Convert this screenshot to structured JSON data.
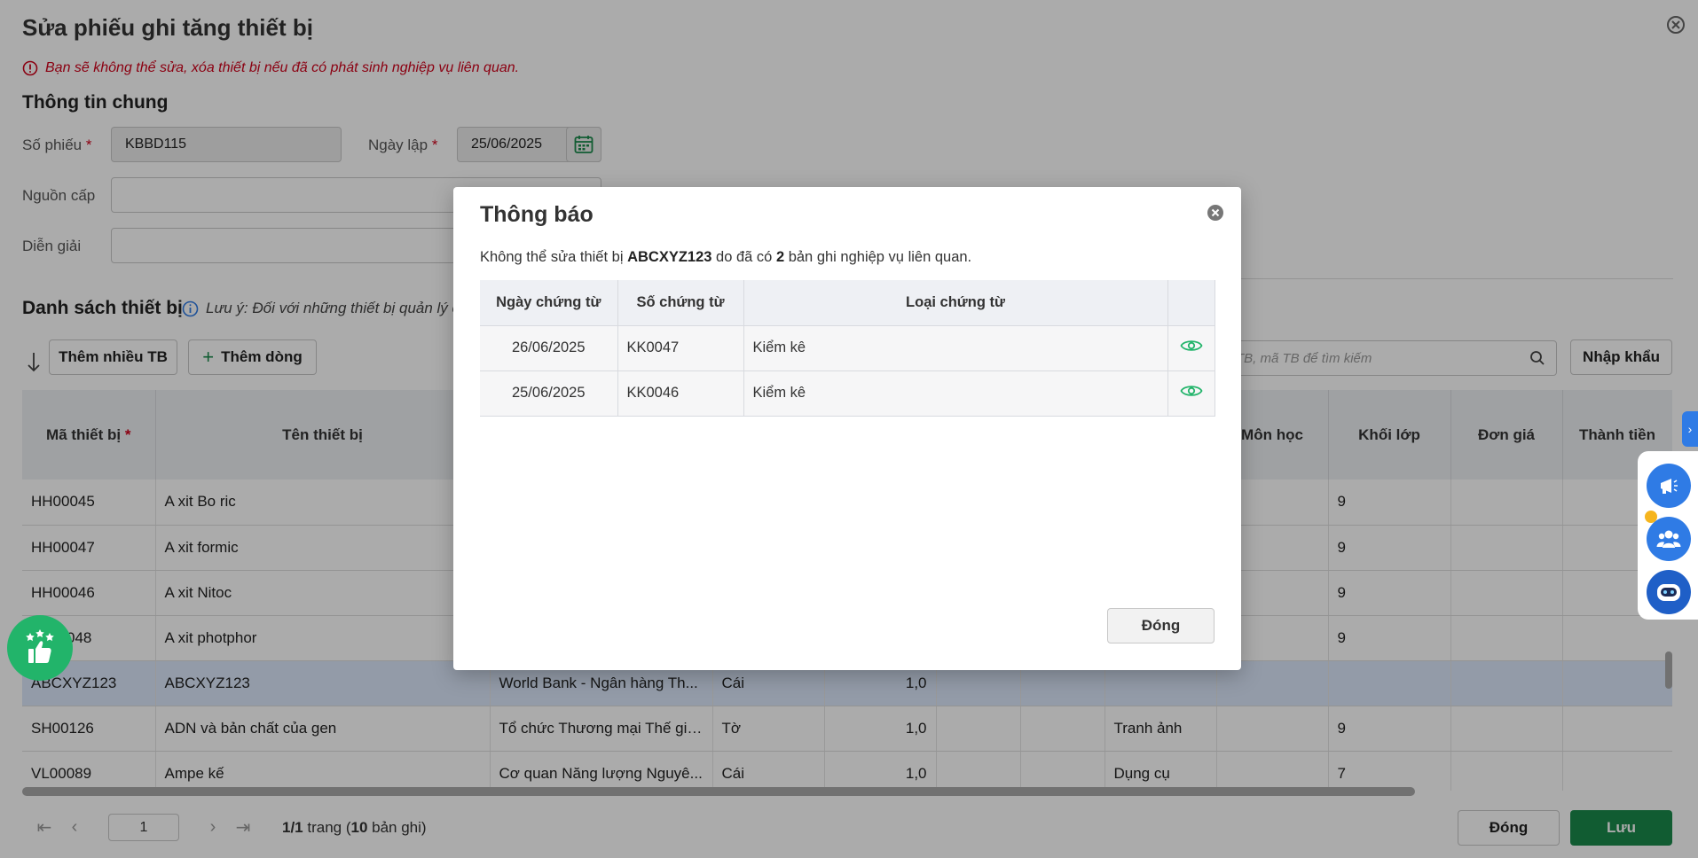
{
  "page": {
    "title": "Sửa phiếu ghi tăng thiết bị",
    "warning": "Bạn sẽ không thể sửa, xóa thiết bị nếu đã có phát sinh nghiệp vụ liên quan.",
    "general_section": "Thông tin chung",
    "form": {
      "so_phieu_label": "Số phiếu",
      "so_phieu_value": "KBBD115",
      "ngay_lap_label": "Ngày lập",
      "ngay_lap_value": "25/06/2025",
      "nguon_cap_label": "Nguồn cấp",
      "dien_giai_label": "Diễn giải",
      "required_mark": "*"
    },
    "list_title": "Danh sách thiết bị",
    "list_note": "Lưu ý: Đối với những thiết bị quản lý c",
    "toolbar": {
      "add_many": "Thêm nhiều TB",
      "add_row": "Thêm dòng",
      "search_placeholder": "TB, mã TB để tìm kiếm",
      "import": "Nhập khẩu"
    },
    "columns": [
      "Mã thiết bị",
      "Tên thiết bị",
      "",
      "",
      "",
      "",
      "",
      "",
      "Môn học",
      "Khối lớp",
      "Đơn giá",
      "Thành tiền"
    ],
    "rows": [
      {
        "ma": "HH00045",
        "ten": "A xit Bo ric",
        "nguon": "",
        "dvt": "",
        "sl": "",
        "mon": "",
        "khoi": "9"
      },
      {
        "ma": "HH00047",
        "ten": "A xit formic",
        "nguon": "",
        "dvt": "",
        "sl": "",
        "mon": "",
        "khoi": "9"
      },
      {
        "ma": "HH00046",
        "ten": "A xit Nitoc",
        "nguon": "",
        "dvt": "",
        "sl": "",
        "mon": "",
        "khoi": "9"
      },
      {
        "ma": "048",
        "ten": "A xit photphor",
        "nguon": "",
        "dvt": "",
        "sl": "",
        "mon": "",
        "khoi": "9"
      },
      {
        "ma": "ABCXYZ123",
        "ten": "ABCXYZ123",
        "nguon": "World Bank - Ngân hàng Th...",
        "dvt": "Cái",
        "sl": "1,0",
        "mon": "",
        "khoi": ""
      },
      {
        "ma": "SH00126",
        "ten": "ADN và bản chất của gen",
        "nguon": "Tổ chức Thương mại Thế giớ...",
        "dvt": "Tờ",
        "sl": "1,0",
        "mon": "Tranh ảnh",
        "khoi": "9"
      },
      {
        "ma": "VL00089",
        "ten": "Ampe kế",
        "nguon": "Cơ quan Năng lượng Nguyê...",
        "dvt": "Cái",
        "sl": "1,0",
        "mon": "Dụng cụ",
        "khoi": "7"
      }
    ],
    "pager": {
      "page": "1",
      "info_current": "1/1",
      "info_mid": " trang (",
      "info_count": "10",
      "info_end": " bản ghi)"
    },
    "footer": {
      "close": "Đóng",
      "save": "Lưu"
    }
  },
  "modal": {
    "title": "Thông báo",
    "msg_prefix": "Không thể sửa thiết bị ",
    "msg_device": "ABCXYZ123",
    "msg_mid": " do đã có ",
    "msg_count": "2",
    "msg_suffix": " bản ghi nghiệp vụ liên quan.",
    "headers": [
      "Ngày chứng từ",
      "Số chứng từ",
      "Loại chứng từ"
    ],
    "rows": [
      {
        "date": "26/06/2025",
        "no": "KK0047",
        "type": "Kiểm kê"
      },
      {
        "date": "25/06/2025",
        "no": "KK0046",
        "type": "Kiểm kê"
      }
    ],
    "close": "Đóng"
  },
  "colors": {
    "accent_green": "#1a8a4b",
    "brand_blue": "#2f7be5",
    "warning_red": "#d0021b",
    "eye_green": "#22b46a"
  }
}
